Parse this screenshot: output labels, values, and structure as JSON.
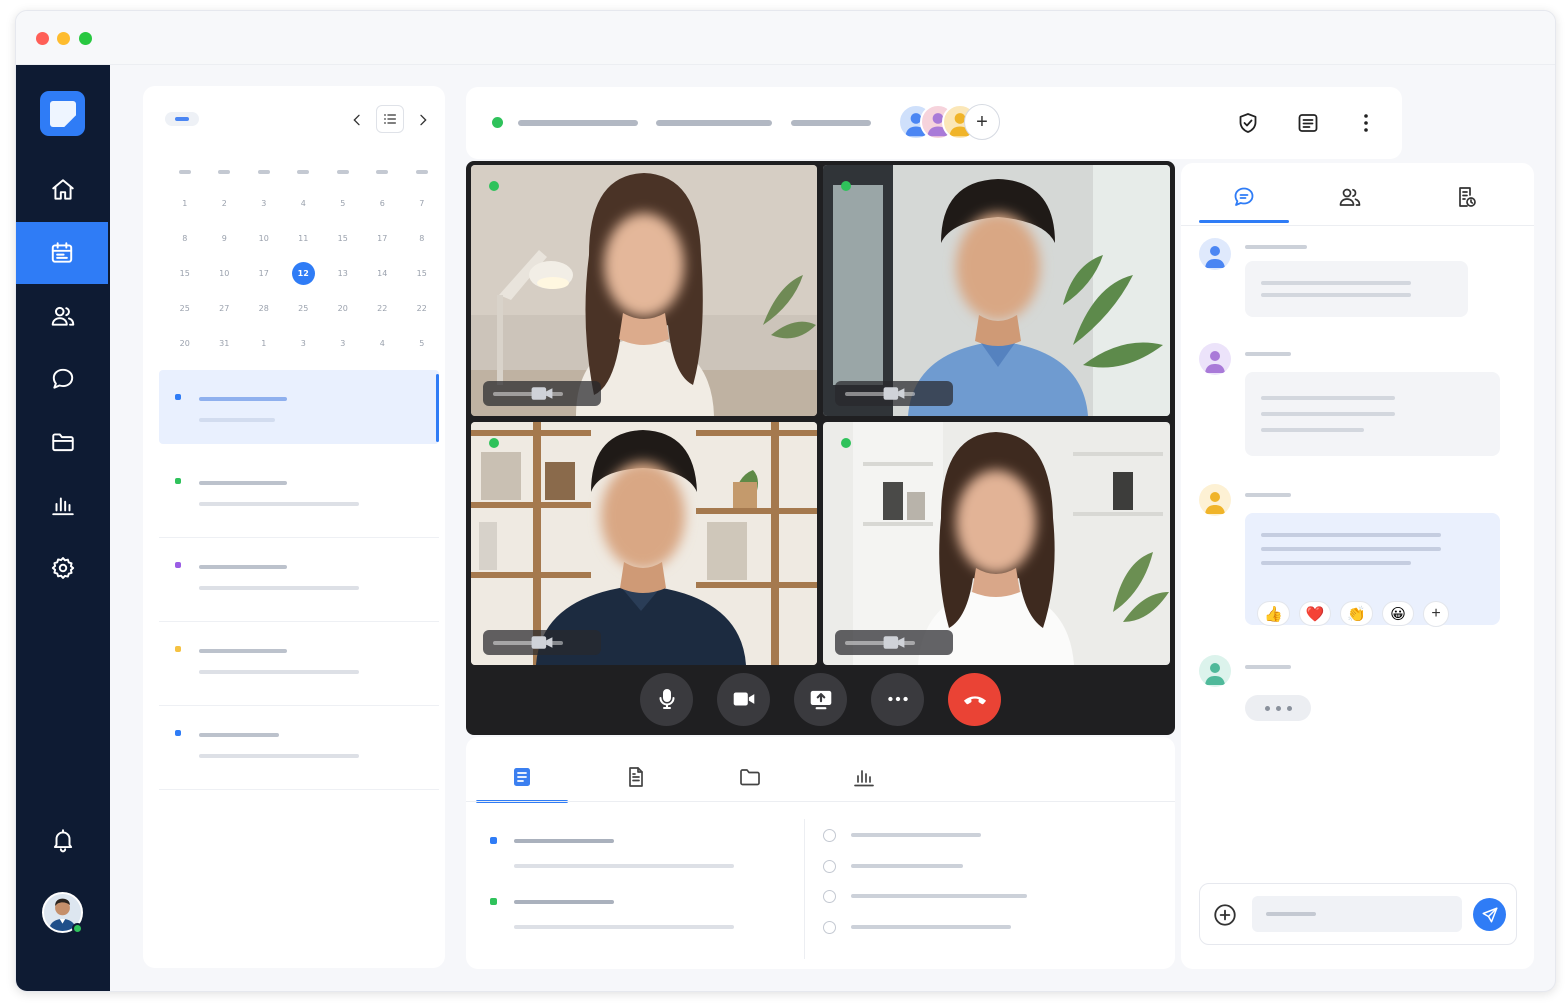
{
  "window": {
    "traffic_lights": [
      "#ff5f57",
      "#febc2e",
      "#28c840"
    ]
  },
  "sidebar": {
    "items": [
      {
        "icon": "home-icon",
        "active": false
      },
      {
        "icon": "calendar-icon",
        "active": true
      },
      {
        "icon": "users-icon",
        "active": false
      },
      {
        "icon": "chat-icon",
        "active": false
      },
      {
        "icon": "folder-icon",
        "active": false
      },
      {
        "icon": "analytics-icon",
        "active": false
      },
      {
        "icon": "settings-icon",
        "active": false
      }
    ],
    "bottom": {
      "icon": "bell-icon",
      "avatar_status": "online"
    }
  },
  "calendar": {
    "weeks": [
      [
        "1",
        "2",
        "3",
        "4",
        "5",
        "6",
        "7"
      ],
      [
        "8",
        "9",
        "10",
        "11",
        "15",
        "17",
        "8"
      ],
      [
        "15",
        "10",
        "17",
        "12",
        "13",
        "14",
        "15"
      ],
      [
        "25",
        "27",
        "28",
        "25",
        "20",
        "22",
        "22"
      ],
      [
        "20",
        "31",
        "1",
        "3",
        "3",
        "4",
        "5"
      ]
    ],
    "today": "12",
    "events": [
      {
        "color": "#2f7cf6",
        "active": true
      },
      {
        "color": "#2fc25b",
        "active": false
      },
      {
        "color": "#9b5de5",
        "active": false
      },
      {
        "color": "#f5c242",
        "active": false
      },
      {
        "color": "#2f7cf6",
        "active": false
      }
    ]
  },
  "meeting": {
    "status_color": "#2fc25b",
    "participants_add_label": "+",
    "actions": [
      "shield-check-icon",
      "notes-icon",
      "more-vertical-icon"
    ]
  },
  "video": {
    "tiles": [
      {
        "status": "live",
        "mic": "camera-small-icon"
      },
      {
        "status": "live",
        "mic": "camera-small-icon"
      },
      {
        "status": "live",
        "mic": "camera-small-icon"
      },
      {
        "status": "live",
        "mic": "camera-small-icon"
      }
    ],
    "controls": [
      "mic-icon",
      "video-camera-icon",
      "share-screen-icon",
      "more-horizontal-icon",
      "end-call-icon"
    ]
  },
  "docs": {
    "tabs": [
      "notes-tab",
      "document-tab",
      "folder-tab",
      "analytics-tab"
    ],
    "active_tab": 0
  },
  "chat": {
    "tabs": [
      "chat-tab",
      "participants-tab",
      "activity-tab"
    ],
    "active_tab": 0,
    "reactions": [
      {
        "emoji": "👍"
      },
      {
        "emoji": "❤️"
      },
      {
        "emoji": "👏"
      },
      {
        "emoji": "😀"
      }
    ],
    "add_reaction_label": "+",
    "accent": "#2f7cf6"
  }
}
